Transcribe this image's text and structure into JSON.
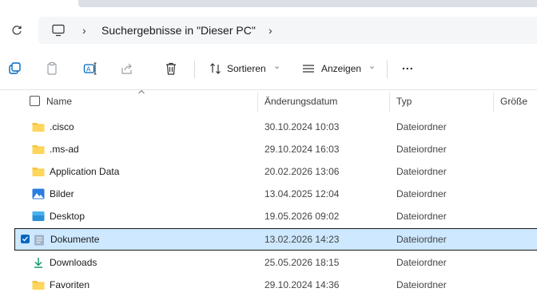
{
  "address": {
    "breadcrumb": "Suchergebnisse in \"Dieser PC\"",
    "separator": "›",
    "next_chevron": "›"
  },
  "toolbar": {
    "sort_label": "Sortieren",
    "view_label": "Anzeigen",
    "more_label": "...",
    "dropdown_caret": "⌄"
  },
  "columns": {
    "name": "Name",
    "date": "Änderungsdatum",
    "type": "Typ",
    "size": "Größe"
  },
  "rows": [
    {
      "name": ".cisco",
      "date": "30.10.2024 10:03",
      "type": "Dateiordner",
      "icon": "folder-icon"
    },
    {
      "name": ".ms-ad",
      "date": "29.10.2024 16:03",
      "type": "Dateiordner",
      "icon": "folder-icon"
    },
    {
      "name": "Application Data",
      "date": "20.02.2026 13:06",
      "type": "Dateiordner",
      "icon": "folder-icon"
    },
    {
      "name": "Bilder",
      "date": "13.04.2025 12:04",
      "type": "Dateiordner",
      "icon": "pictures-folder-icon"
    },
    {
      "name": "Desktop",
      "date": "19.05.2026 09:02",
      "type": "Dateiordner",
      "icon": "desktop-folder-icon"
    },
    {
      "name": "Dokumente",
      "date": "13.02.2026 14:23",
      "type": "Dateiordner",
      "icon": "documents-folder-icon",
      "selected": true
    },
    {
      "name": "Downloads",
      "date": "25.05.2026 18:15",
      "type": "Dateiordner",
      "icon": "downloads-folder-icon"
    },
    {
      "name": "Favoriten",
      "date": "29.10.2024 14:36",
      "type": "Dateiordner",
      "icon": "folder-icon"
    }
  ],
  "colors": {
    "folder": "#f4c53c",
    "selection_bg": "#cde8ff",
    "accent": "#0067c0"
  }
}
